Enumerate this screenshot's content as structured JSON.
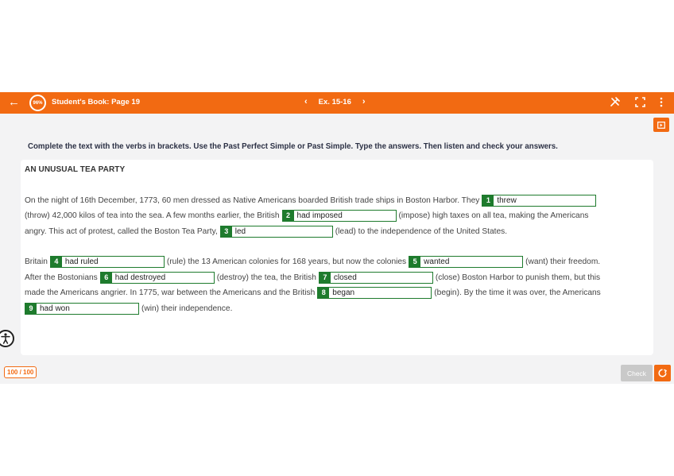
{
  "topbar": {
    "back_icon": "arrow-left-icon",
    "progress_badge": "96%",
    "title": "Student's Book: Page 19",
    "exercise": "Ex. 15-16",
    "tools": [
      "tools-icon",
      "fullscreen-icon",
      "more-vertical-icon"
    ]
  },
  "instruction": "Complete the text with the verbs in brackets. Use the Past Perfect Simple or Past Simple. Type the answers. Then listen and check your answers.",
  "heading": "AN UNUSUAL TEA PARTY",
  "lines": {
    "l1": {
      "a": "On the night of 16th December, 1773, 60 men dressed as Native Americans boarded British trade ships in Boston Harbor. They",
      "b1": {
        "num": "1",
        "val": "threw"
      }
    },
    "l2": {
      "a": "(throw) 42,000 kilos of tea into the sea. A few months earlier, the British",
      "b2": {
        "num": "2",
        "val": "had imposed"
      },
      "c": "(impose) high taxes on all tea, making the Americans"
    },
    "l3": {
      "a": "angry. This act of protest, called the Boston Tea Party,",
      "b3": {
        "num": "3",
        "val": "led"
      },
      "c": "(lead) to the independence of the United States."
    },
    "l4": {
      "a": "Britain",
      "b4": {
        "num": "4",
        "val": "had ruled"
      },
      "c": "(rule) the 13 American colonies for 168 years, but now the colonies",
      "b5": {
        "num": "5",
        "val": "wanted"
      },
      "d": "(want) their freedom."
    },
    "l5": {
      "a": "After the Bostonians",
      "b6": {
        "num": "6",
        "val": "had destroyed"
      },
      "c": "(destroy) the tea, the British",
      "b7": {
        "num": "7",
        "val": "closed"
      },
      "d": "(close) Boston Harbor to punish them, but this"
    },
    "l6": {
      "a": "made the Americans angrier. In 1775, war between the Americans and the British",
      "b8": {
        "num": "8",
        "val": "began"
      },
      "c": "(begin). By the time it was over, the Americans"
    },
    "l7": {
      "b9": {
        "num": "9",
        "val": "had won"
      },
      "c": "(win) their independence."
    }
  },
  "footer": {
    "score": "100 / 100",
    "check_label": "Check",
    "submit_icon": "submit-icon",
    "accessibility_icon": "accessibility-icon"
  },
  "media_icon": "play-video-icon",
  "colors": {
    "accent": "#f26a12",
    "correct": "#1e7b2d"
  }
}
